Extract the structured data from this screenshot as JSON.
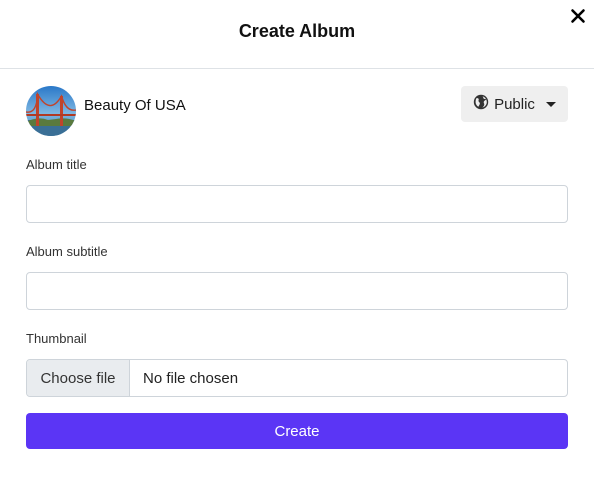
{
  "modal": {
    "title": "Create Album"
  },
  "owner": {
    "name": "Beauty Of USA"
  },
  "privacy": {
    "selected": "Public"
  },
  "fields": {
    "album_title": {
      "label": "Album title",
      "value": "",
      "placeholder": ""
    },
    "album_subtitle": {
      "label": "Album subtitle",
      "value": "",
      "placeholder": ""
    },
    "thumbnail": {
      "label": "Thumbnail",
      "button_label": "Choose file",
      "status": "No file chosen"
    }
  },
  "actions": {
    "create_label": "Create"
  },
  "colors": {
    "primary": "#5b35f5",
    "privacy_button_bg": "#efefef",
    "file_button_bg": "#e9ecef",
    "border": "#ced4da"
  },
  "icons": {
    "close": "close-icon",
    "privacy": "globe-icon",
    "dropdown": "caret-down-icon"
  }
}
